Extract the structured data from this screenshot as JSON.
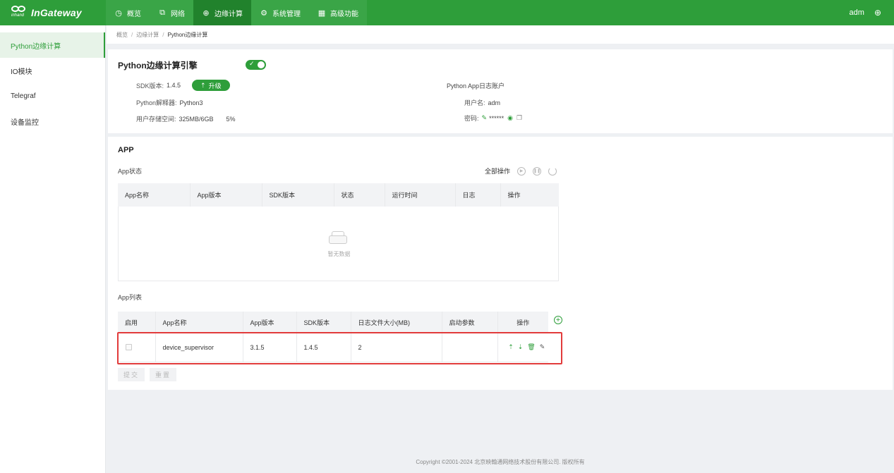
{
  "brand": {
    "name": "InGateway",
    "logo_sub": "inhand"
  },
  "nav": [
    {
      "label": "概览",
      "icon": "dashboard-icon"
    },
    {
      "label": "网络",
      "icon": "network-icon"
    },
    {
      "label": "边缘计算",
      "icon": "edge-compute-icon",
      "active": true
    },
    {
      "label": "系统管理",
      "icon": "gear-icon"
    },
    {
      "label": "高级功能",
      "icon": "grid-icon"
    }
  ],
  "user": {
    "name": "adm"
  },
  "sidebar": {
    "items": [
      {
        "label": "Python边缘计算",
        "active": true
      },
      {
        "label": "IO模块"
      },
      {
        "label": "Telegraf"
      },
      {
        "label": "设备监控"
      }
    ]
  },
  "breadcrumb": {
    "items": [
      "概览",
      "边缘计算",
      "Python边缘计算"
    ]
  },
  "engine": {
    "title": "Python边缘计算引擎",
    "enabled": true,
    "sdk_label": "SDK版本:",
    "sdk_version": "1.4.5",
    "upgrade_label": "升级",
    "interpreter_label": "Python解释器:",
    "interpreter": "Python3",
    "storage_label": "用户存储空间:",
    "storage": "325MB/6GB",
    "storage_pct": "5%",
    "log_account_title": "Python App日志账户",
    "username_label": "用户名:",
    "username": "adm",
    "password_label": "密码:",
    "password_mask": "******"
  },
  "app": {
    "title": "APP",
    "status_label": "App状态",
    "all_ops_label": "全部操作",
    "status_columns": [
      "App名称",
      "App版本",
      "SDK版本",
      "状态",
      "运行时间",
      "日志",
      "操作"
    ],
    "empty_text": "暂无数据",
    "list_label": "App列表",
    "list_columns": [
      "启用",
      "App名称",
      "App版本",
      "SDK版本",
      "日志文件大小(MB)",
      "启动参数",
      "操作"
    ],
    "rows": [
      {
        "enabled": false,
        "name": "device_supervisor",
        "app_version": "3.1.5",
        "sdk_version": "1.4.5",
        "log_size": "2",
        "params": ""
      }
    ],
    "submit_label": "提交",
    "reset_label": "重置"
  },
  "footer": {
    "copyright": "Copyright ©2001-2024 北京映翰通网络技术股份有限公司. 版权所有"
  }
}
